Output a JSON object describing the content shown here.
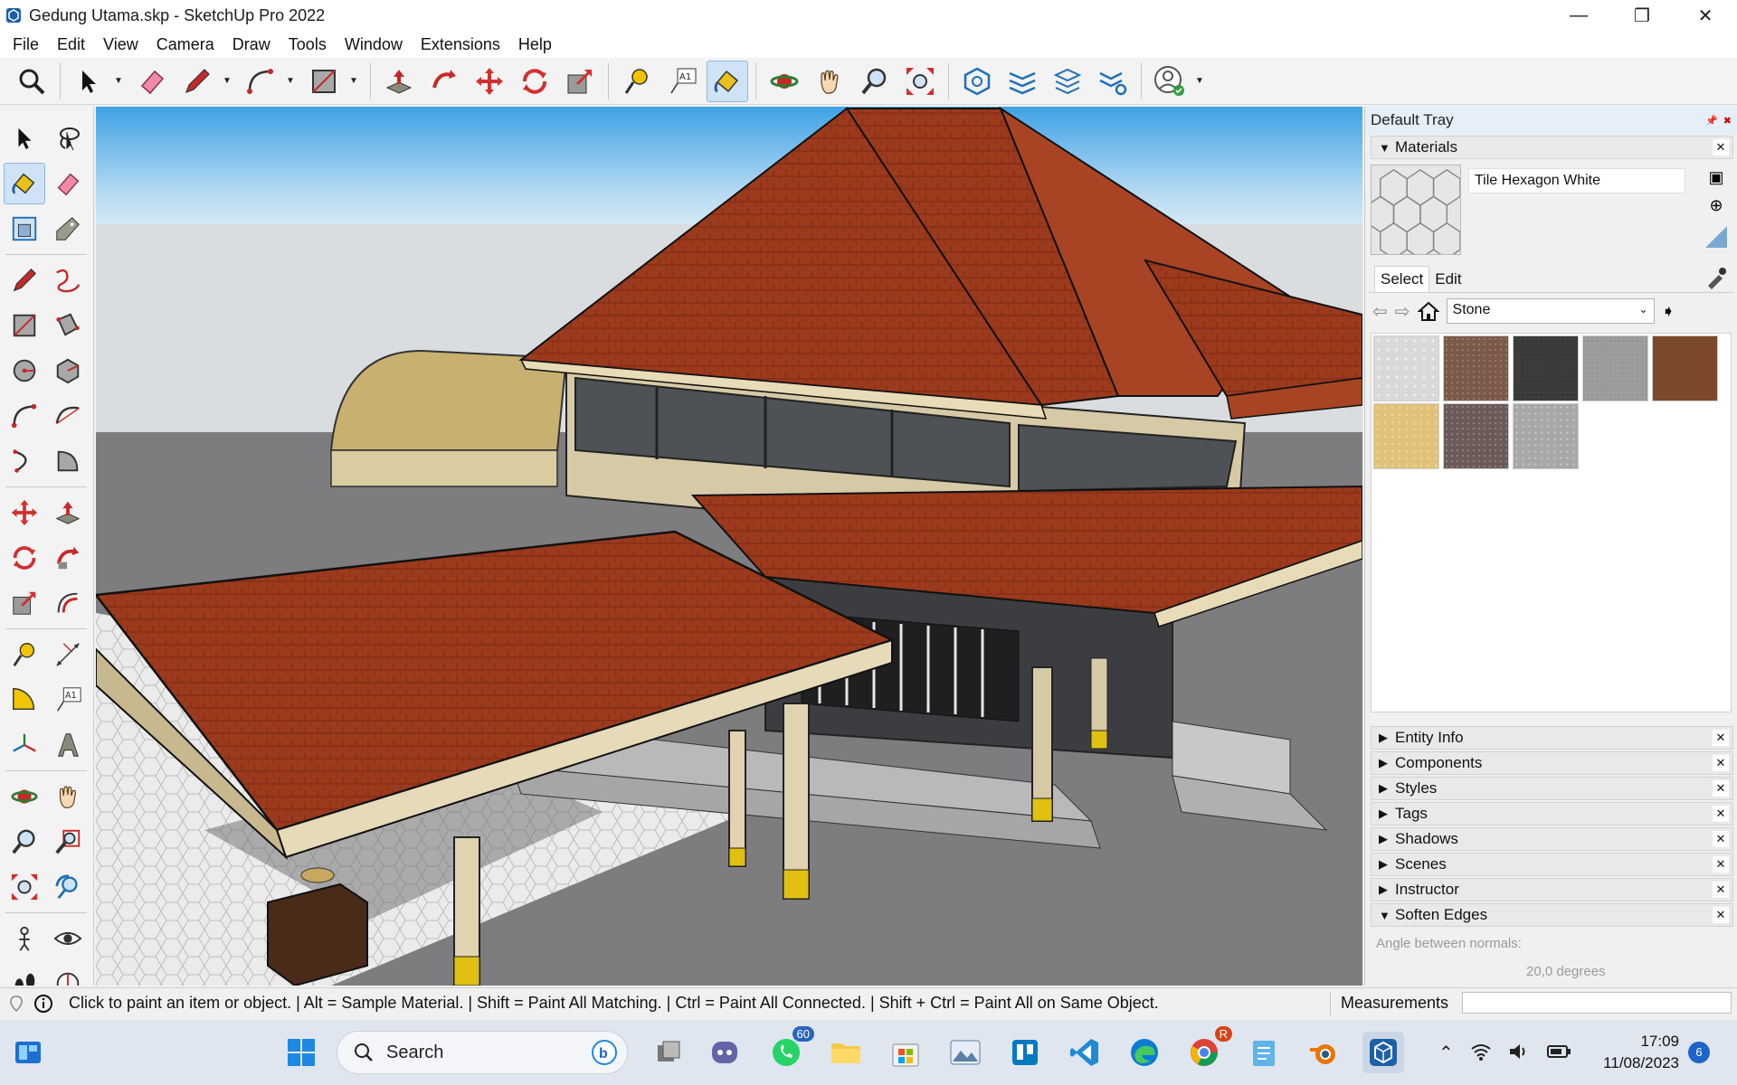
{
  "window": {
    "title": "Gedung Utama.skp - SketchUp Pro 2022",
    "minimize": "—",
    "maximize": "❐",
    "close": "✕"
  },
  "menu": [
    "File",
    "Edit",
    "View",
    "Camera",
    "Draw",
    "Tools",
    "Window",
    "Extensions",
    "Help"
  ],
  "toolbar": {
    "icons": [
      "search-zoom-icon",
      "select-arrow-icon",
      "eraser-icon",
      "pencil-line-icon",
      "arc-icon",
      "rectangle-icon",
      "push-pull-icon",
      "follow-me-icon",
      "move-icon",
      "rotate-icon",
      "scale-icon",
      "tape-measure-icon",
      "text-label-icon",
      "paint-bucket-icon",
      "orbit-icon",
      "pan-hand-icon",
      "zoom-icon",
      "zoom-extents-icon",
      "solid-tools-icon",
      "sandbox-icon",
      "layers-icon",
      "settings-layers-icon",
      "profile-account-icon"
    ],
    "text_label": "A1"
  },
  "tray": {
    "title": "Default Tray",
    "materials": {
      "header": "Materials",
      "current_material": "Tile Hexagon White",
      "tab_select": "Select",
      "tab_edit": "Edit",
      "library": "Stone",
      "swatch_colors": [
        "#d9d9d9",
        "#7a5a4a",
        "#3a3a3a",
        "#9a9a9a",
        "#7a4a2a",
        "#e2c27a",
        "#6a5a58",
        "#a8a8a8"
      ]
    },
    "panels": [
      "Entity Info",
      "Components",
      "Styles",
      "Tags",
      "Shadows",
      "Scenes",
      "Instructor"
    ],
    "soften_edges": {
      "header": "Soften Edges",
      "angle_label": "Angle between normals:",
      "angle_value": "20,0  degrees"
    }
  },
  "status": {
    "hint": "Click to paint an item or object. | Alt = Sample Material. | Shift = Paint All Matching. | Ctrl = Paint All Connected. | Shift + Ctrl = Paint All on Same Object.",
    "measurements_label": "Measurements"
  },
  "taskbar": {
    "search_placeholder": "Search",
    "whatsapp_badge": "60",
    "time": "17:09",
    "date": "11/08/2023",
    "notifications": "6",
    "chrome_badge": "R"
  },
  "colors": {
    "sky_top": "#4fa9e6",
    "roof": "#9b3b1e",
    "accent_blue": "#0078d4"
  }
}
